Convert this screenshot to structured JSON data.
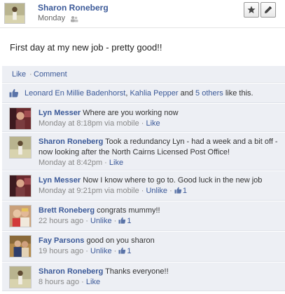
{
  "post": {
    "author": "Sharon Roneberg",
    "time": "Monday",
    "text": "First day at my new job - pretty good!!",
    "star_icon": "star-icon",
    "edit_icon": "pencil-icon"
  },
  "actions": {
    "like": "Like",
    "separator": "·",
    "comment": "Comment"
  },
  "likes": {
    "name1": "Leonard En Millie Badenhorst",
    "sep1": ",",
    "name2": "Kahlia Pepper",
    "and": "and",
    "others": "5 others",
    "suffix": "like this."
  },
  "comments": [
    {
      "name": "Lyn Messer",
      "text": "Where are you working now",
      "time": "Monday at 8:18pm via mobile",
      "action": "Like",
      "count": ""
    },
    {
      "name": "Sharon Roneberg",
      "text": "Took a redundancy Lyn - had a week and a bit off - now looking after the North Cairns Licensed Post Office!",
      "time": "Monday at 8:42pm",
      "action": "Like",
      "count": ""
    },
    {
      "name": "Lyn Messer",
      "text": "Now I know where to go to. Good luck in the new job",
      "time": "Monday at 9:21pm via mobile",
      "action": "Unlike",
      "count": "1"
    },
    {
      "name": "Brett Roneberg",
      "text": "congrats mummy!!",
      "time": "22 hours ago",
      "action": "Unlike",
      "count": "1"
    },
    {
      "name": "Fay Parsons",
      "text": "good on you sharon",
      "time": "19 hours ago",
      "action": "Unlike",
      "count": "1"
    },
    {
      "name": "Sharon Roneberg",
      "text": "Thanks everyone!!",
      "time": "8 hours ago",
      "action": "Like",
      "count": ""
    }
  ],
  "colors": {
    "link": "#3b5998",
    "panel": "#edeff4",
    "meta": "#888888"
  }
}
